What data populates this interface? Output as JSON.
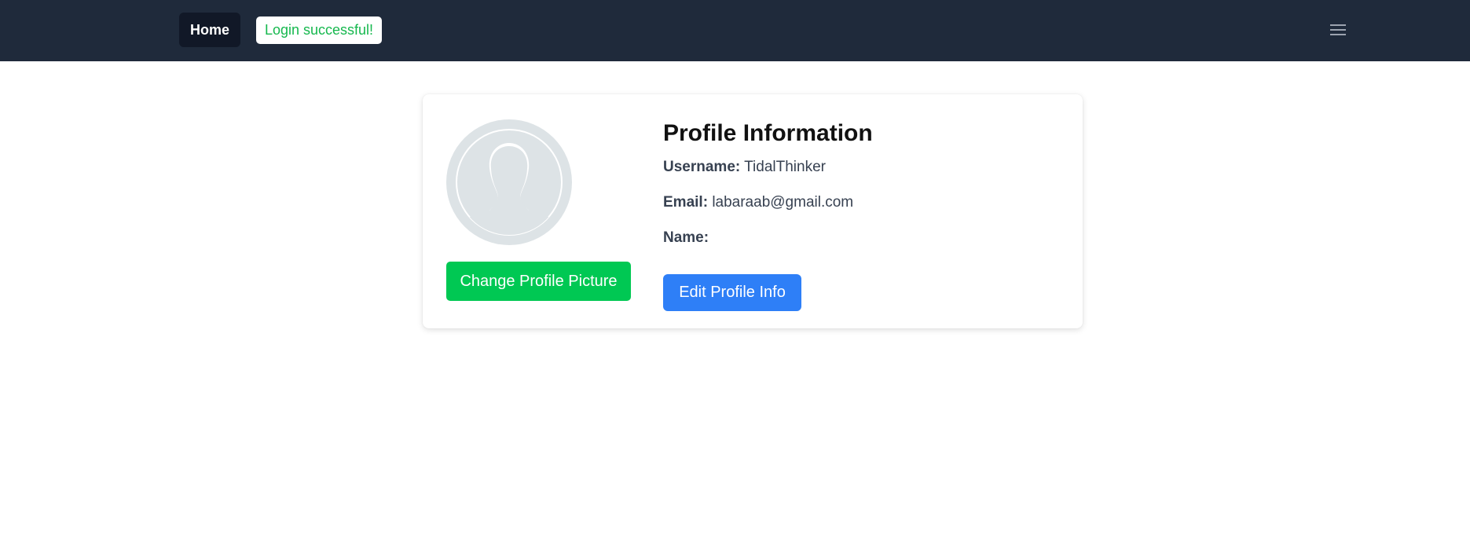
{
  "navbar": {
    "home_label": "Home",
    "toast_message": "Login successful!",
    "menu_icon": "hamburger-menu-icon"
  },
  "profile": {
    "avatar_icon": "default-user-avatar-icon",
    "change_picture_label": "Change Profile Picture",
    "title": "Profile Information",
    "username_label": "Username:",
    "username_value": "TidalThinker",
    "email_label": "Email:",
    "email_value": "labaraab@gmail.com",
    "name_label": "Name:",
    "name_value": "",
    "edit_label": "Edit Profile Info"
  },
  "colors": {
    "navbar_bg": "#1f2a3b",
    "home_bg": "#111827",
    "toast_text": "#16b84e",
    "change_picture_bg": "#00c853",
    "edit_bg": "#2e7ff7"
  }
}
